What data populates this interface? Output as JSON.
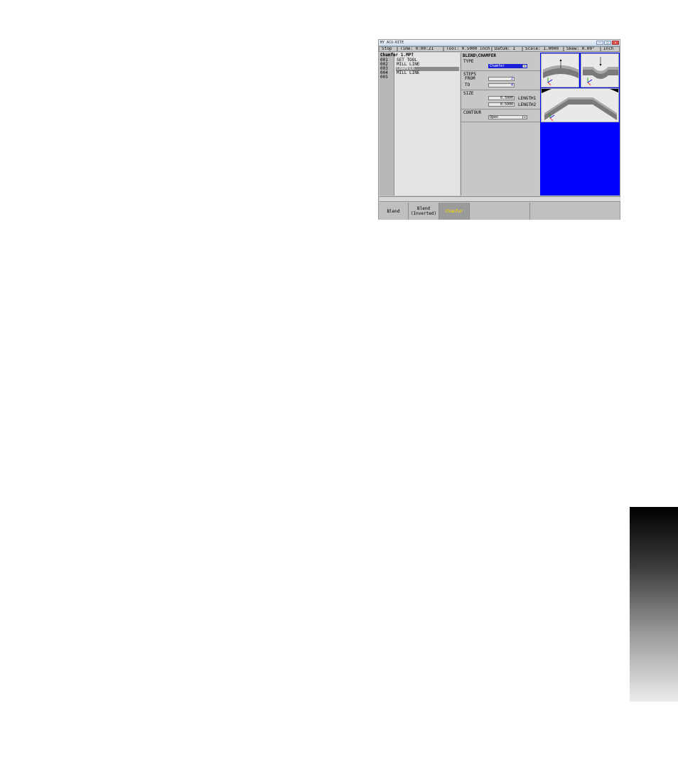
{
  "window": {
    "title": "MY ACU-RITE",
    "buttons": [
      "minimize",
      "maximize",
      "close"
    ]
  },
  "status": {
    "mode": "Stop",
    "time": "Time:     0:00:21",
    "tool": "Tool: 0.5000  inch",
    "datum": "Datum: 1",
    "scale": "Scale: 1.0000",
    "skew": "Skew: 0.00°",
    "units": "Inch"
  },
  "program": {
    "title": "Chamfer 1.MPT",
    "lines": [
      {
        "num": "001",
        "cmd": "SET TOOL"
      },
      {
        "num": "002",
        "cmd": "MILL LINE"
      },
      {
        "num": "003",
        "cmd": "CHAMFER"
      },
      {
        "num": "004",
        "cmd": "MILL LINE"
      },
      {
        "num": "005",
        "cmd": ""
      }
    ]
  },
  "form": {
    "heading": "BLEND\\CHAMFER",
    "type_label": "TYPE",
    "type_value": "Chamfer",
    "steps_label": "STEPS",
    "from_label": "FROM",
    "from_value": "2",
    "to_label": "TO",
    "to_value": "4",
    "size_label": "SIZE",
    "length1_value": "0.5000",
    "length1_label": "LENGTH1",
    "length2_value": "0.5000",
    "length2_label": "LENGTH2",
    "contour_label": "CONTOUR",
    "contour_value": "Open"
  },
  "preview": {
    "axis_y": "Y",
    "axis_x": "X"
  },
  "softkeys": [
    "Blend",
    "Blend\n(Inverted)",
    "Chamfer",
    "",
    ""
  ],
  "colors": {
    "preview_bg": "#0000ff",
    "selected_field": "#1a20d8",
    "active_softkey_text": "#ffe000"
  }
}
